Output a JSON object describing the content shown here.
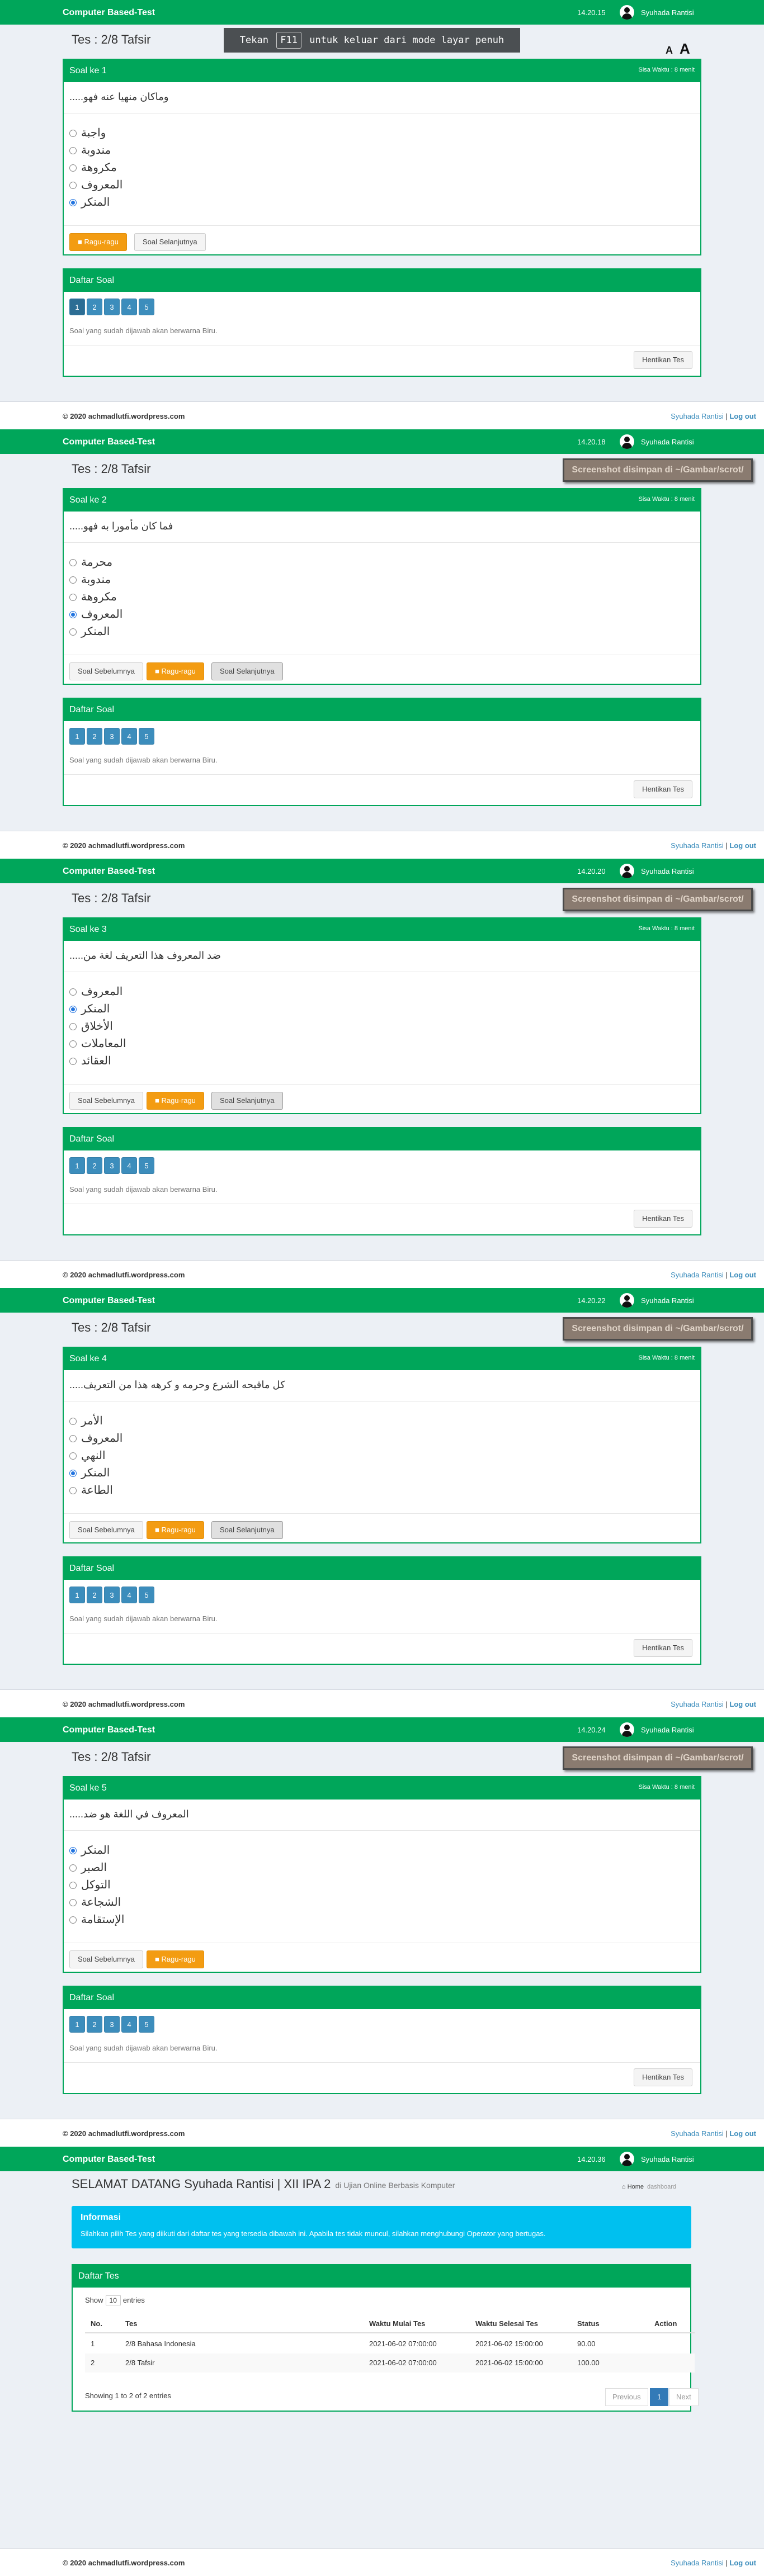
{
  "app": {
    "brand": "Computer Based-Test",
    "user": "Syuhada Rantisi"
  },
  "page_title": "Tes : 2/8 Tafsir",
  "f11": {
    "before": "Tekan",
    "key": "F11",
    "after": "untuk keluar dari mode layar penuh"
  },
  "font_controls": {
    "small": "A",
    "large": "A"
  },
  "toast": "Screenshot disimpan di ~/Gambar/scrot/",
  "sisa": "Sisa Waktu : 8 menit",
  "labels": {
    "prev": "Soal Sebelumnya",
    "ragu": "■ Ragu-ragu",
    "next": "Soal Selanjutnya",
    "daftar": "Daftar Soal",
    "note": "Soal yang sudah dijawab akan berwarna Biru.",
    "stop": "Hentikan Tes"
  },
  "footer": {
    "copyright": "© 2020 achmadlutfi.wordpress.com",
    "user": "Syuhada Rantisi",
    "sep": " | ",
    "logout": "Log out"
  },
  "numbers": [
    "1",
    "2",
    "3",
    "4",
    "5"
  ],
  "panels": [
    {
      "time": "14.20.15",
      "soal": "Soal ke 1",
      "question": "وماكان منهيا عنه فهو.....",
      "options": [
        "واجبة",
        "مندوبة",
        "مكروهة",
        "المعروف",
        "المنكر"
      ],
      "selected": 4,
      "has_prev": false
    },
    {
      "time": "14.20.18",
      "soal": "Soal ke 2",
      "question": "فما كان مأمورا به فهو.....",
      "options": [
        "محرمة",
        "مندوبة",
        "مكروهة",
        "المعروف",
        "المنكر"
      ],
      "selected": 3,
      "has_prev": true
    },
    {
      "time": "14.20.20",
      "soal": "Soal ke 3",
      "question": "ضد المعروف هذا التعريف لغة من.....",
      "options": [
        "المعروف",
        "المنكر",
        "الأخلاق",
        "المعاملات",
        "العقائد"
      ],
      "selected": 1,
      "has_prev": true
    },
    {
      "time": "14.20.22",
      "soal": "Soal ke 4",
      "question": "كل ماقبحه الشرع وحرمه و كرهه هذا من التعريف.....",
      "options": [
        "الأمر",
        "المعروف",
        "النهي",
        "المنكر",
        "الطاعة"
      ],
      "selected": 3,
      "has_prev": true
    },
    {
      "time": "14.20.24",
      "soal": "Soal ke 5",
      "question": "المعروف في اللغة هو ضد.....",
      "options": [
        "المنكر",
        "الصبر",
        "التوكل",
        "الشجاعة",
        "الإستقامة"
      ],
      "selected": 0,
      "has_prev": true
    }
  ],
  "dashboard": {
    "time": "14.20.36",
    "welcome": "SELAMAT DATANG Syuhada Rantisi | XII IPA 2",
    "welcome_sub": "di Ujian Online Berbasis Komputer",
    "crumb_home": "Home",
    "crumb_current": "dashboard",
    "info_title": "Informasi",
    "info_text": "Silahkan pilih Tes yang diikuti dari daftar tes yang tersedia dibawah ini. Apabila tes tidak muncul, silahkan menghubungi Operator yang bertugas.",
    "table_title": "Daftar Tes",
    "show": "Show",
    "entries_value": "10",
    "entries": "entries",
    "headers": [
      "No.",
      "Tes",
      "Waktu Mulai Tes",
      "Waktu Selesai Tes",
      "Status",
      "Action"
    ],
    "rows": [
      [
        "1",
        "2/8 Bahasa Indonesia",
        "2021-06-02 07:00:00",
        "2021-06-02 15:00:00",
        "90.00",
        ""
      ],
      [
        "2",
        "2/8 Tafsir",
        "2021-06-02 07:00:00",
        "2021-06-02 15:00:00",
        "100.00",
        ""
      ]
    ],
    "showing": "Showing 1 to 2 of 2 entries",
    "pager": [
      "Previous",
      "1",
      "Next"
    ]
  }
}
